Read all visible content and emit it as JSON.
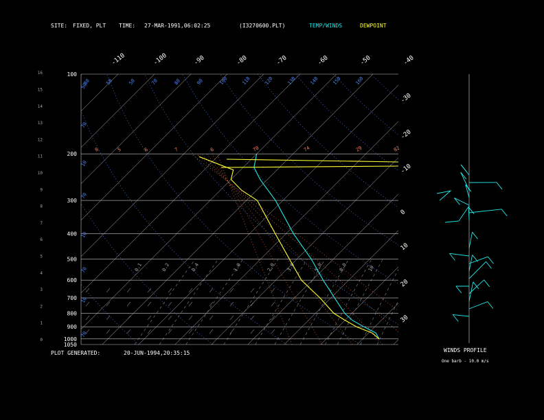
{
  "header": {
    "site_label": "SITE:",
    "site_value": "FIXED, PLT",
    "time_label": "TIME:",
    "time_value": "27-MAR-1991,06:02:25",
    "file": "(I3270600.PLT)",
    "legend_temp": "TEMP/WINDS",
    "legend_dew": "DEWPOINT"
  },
  "footer": {
    "generated_label": "PLOT GENERATED:",
    "generated_value": "20-JUN-1994,20:35:15",
    "winds_title": "WINDS PROFILE",
    "barb_note": "One barb - 10.0 m/s"
  },
  "colors": {
    "temp": "#22e6e6",
    "dew": "#ffff33",
    "grid": "#c8c8c8",
    "mixing": "#4f86f7",
    "dry_adiabat": "#e26d3a",
    "label_salmon": "#f08060"
  },
  "chart_data": {
    "type": "line",
    "subtype": "skew-T log-P",
    "pressure_levels": [
      100,
      200,
      300,
      400,
      500,
      600,
      700,
      800,
      900,
      1000,
      1050
    ],
    "pressure_tick_labels": [
      "100",
      "200",
      "300",
      "400",
      "500",
      "600",
      "700",
      "800",
      "900",
      "1000",
      "1050"
    ],
    "height_ticks_km": [
      "0",
      "1",
      "2",
      "3",
      "4",
      "5",
      "6",
      "7",
      "8",
      "9",
      "10",
      "11",
      "12",
      "13",
      "14",
      "15",
      "16"
    ],
    "top_isotherm_labels": [
      "-110",
      "-100",
      "-90",
      "-80",
      "-70",
      "-60",
      "-50",
      "-40"
    ],
    "right_isotherm_labels": [
      "-30",
      "-20",
      "-10",
      "0",
      "10",
      "20",
      "30"
    ],
    "dry_adiabat_labels": [
      "8",
      "5",
      "6",
      "7",
      "6",
      "70",
      "74",
      "29",
      "82"
    ],
    "top_row_labels": [
      "80",
      "50",
      "50",
      "70",
      "80",
      "90",
      "100",
      "110",
      "120",
      "130",
      "140",
      "150",
      "160"
    ],
    "mixing_ratio_labels": [
      "0.1",
      "0.2",
      "0.4",
      "1.0",
      "2.0",
      "3.0",
      "5.0",
      "8.0",
      "10"
    ],
    "left_theta_labels": [
      "50",
      "70",
      "10",
      "70",
      "10",
      "70",
      "10",
      "70",
      "10",
      "20"
    ],
    "series": [
      {
        "name": "TEMP/WINDS",
        "points_t_p": [
          [
            24.5,
            1000
          ],
          [
            22,
            950
          ],
          [
            17,
            900
          ],
          [
            12,
            850
          ],
          [
            8,
            800
          ],
          [
            1,
            700
          ],
          [
            -7,
            600
          ],
          [
            -16,
            500
          ],
          [
            -28,
            400
          ],
          [
            -42,
            300
          ],
          [
            -52,
            250
          ],
          [
            -57,
            225
          ],
          [
            -60,
            200
          ]
        ]
      },
      {
        "name": "DEWPOINT",
        "points_t_p": [
          [
            24.5,
            1000
          ],
          [
            21,
            950
          ],
          [
            15,
            900
          ],
          [
            10,
            850
          ],
          [
            5,
            800
          ],
          [
            -3,
            700
          ],
          [
            -13,
            600
          ],
          [
            -22,
            500
          ],
          [
            -33,
            400
          ],
          [
            -47,
            300
          ],
          [
            -54,
            275
          ],
          [
            -60,
            250
          ],
          [
            -62,
            230
          ],
          [
            -75,
            205
          ]
        ]
      }
    ],
    "wind_profile_barbs": 19
  }
}
